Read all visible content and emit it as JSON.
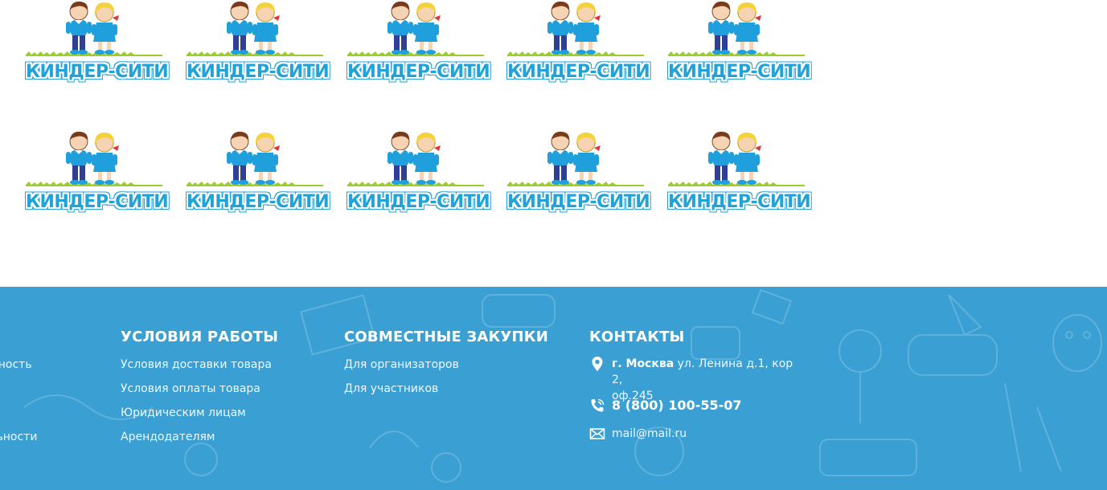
{
  "logo": {
    "text": "КИНДЕР-СИТИ"
  },
  "footer": {
    "left_partial": [
      "енность",
      "альности"
    ],
    "work": {
      "title": "УСЛОВИЯ РАБОТЫ",
      "links": [
        "Условия доставки товара",
        "Условия оплаты товара",
        "Юридическим лицам",
        "Арендодателям"
      ]
    },
    "purchases": {
      "title": "СОВМЕСТНЫЕ ЗАКУПКИ",
      "links": [
        "Для организаторов",
        "Для участников"
      ]
    },
    "contacts": {
      "title": "КОНТАКТЫ",
      "city": "г. Москва",
      "address": "ул. Ленина д.1, кор 2,",
      "office": "оф.245",
      "phone": "8 (800) 100-55-07",
      "email": "mail@mail.ru"
    },
    "colors": {
      "background": "#3aa0d3",
      "logo_blue": "#21a2d9",
      "grass": "#9ccc2e"
    }
  }
}
